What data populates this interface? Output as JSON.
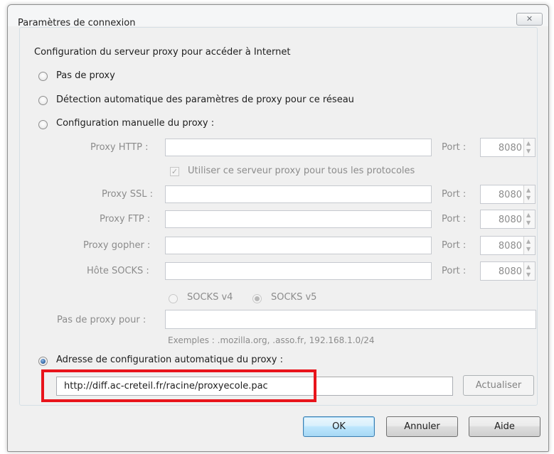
{
  "window": {
    "title": "Paramètres de connexion",
    "close_glyph": "✕"
  },
  "group": {
    "legend": "Configuration du serveur proxy pour accéder à Internet"
  },
  "proxy_modes": {
    "none": "Pas de proxy",
    "auto_detect": "Détection automatique des paramètres de proxy pour ce réseau",
    "manual": "Configuration manuelle du proxy :",
    "auto_config": "Adresse de configuration automatique du proxy :",
    "selected": "auto_config"
  },
  "manual": {
    "http_label": "Proxy HTTP :",
    "http_value": "",
    "http_port_label": "Port :",
    "http_port": "8080",
    "same_proxy_label": "Utiliser ce serveur proxy pour tous les protocoles",
    "same_proxy_checked": true,
    "ssl_label": "Proxy SSL :",
    "ssl_value": "",
    "ssl_port_label": "Port :",
    "ssl_port": "8080",
    "ftp_label": "Proxy FTP :",
    "ftp_value": "",
    "ftp_port_label": "Port :",
    "ftp_port": "8080",
    "gopher_label": "Proxy gopher :",
    "gopher_value": "",
    "gopher_port_label": "Port :",
    "gopher_port": "8080",
    "socks_label": "Hôte SOCKS :",
    "socks_value": "",
    "socks_port_label": "Port :",
    "socks_port": "8080",
    "socks_v4": "SOCKS v4",
    "socks_v5": "SOCKS v5",
    "socks_selected": "v5",
    "no_proxy_label": "Pas de proxy pour :",
    "no_proxy_value": "",
    "examples": "Exemples : .mozilla.org, .asso.fr, 192.168.1.0/24"
  },
  "auto_config": {
    "url": "http://diff.ac-creteil.fr/racine/proxyecole.pac",
    "reload_label": "Actualiser"
  },
  "buttons": {
    "ok": "OK",
    "cancel": "Annuler",
    "help": "Aide"
  },
  "colors": {
    "highlight": "#e8141b",
    "dialog_bg": "#f0f0f0",
    "default_button_border": "#3c7fb1"
  }
}
